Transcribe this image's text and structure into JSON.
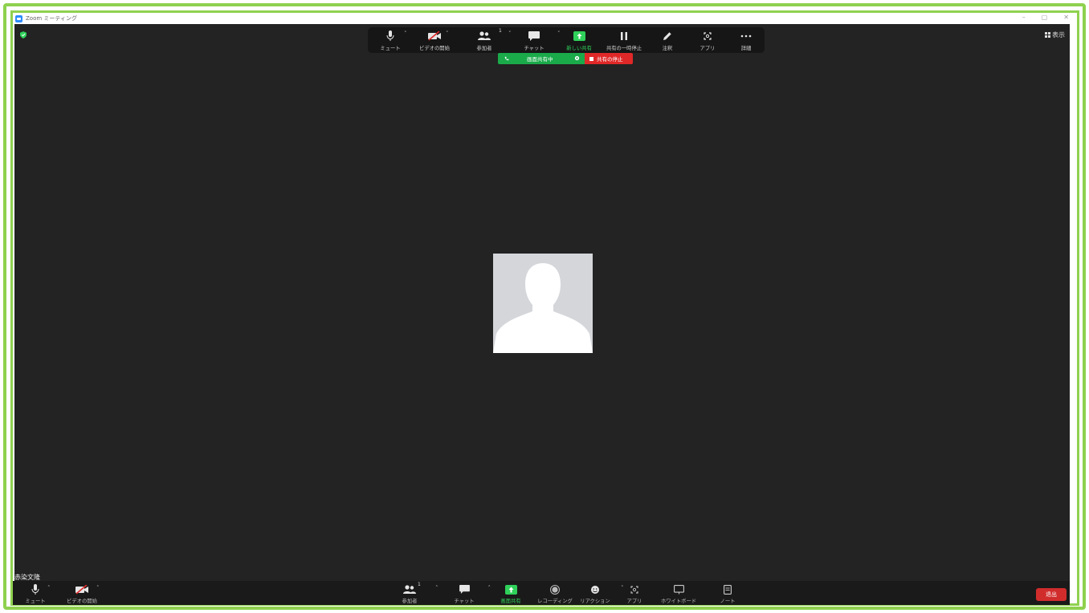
{
  "window": {
    "title": "Zoom ミーティング",
    "controls": [
      "–",
      "▢",
      "✕"
    ]
  },
  "top_toolbar": {
    "items": [
      {
        "label": "ミュート",
        "icon": "mic-icon"
      },
      {
        "label": "ビデオの開始",
        "icon": "video-off-icon"
      },
      {
        "label": "参加者",
        "icon": "participants-icon",
        "count": "1"
      },
      {
        "label": "チャット",
        "icon": "chat-icon"
      },
      {
        "label": "新しい共有",
        "icon": "share-screen-icon"
      },
      {
        "label": "共有の一時停止",
        "icon": "pause-icon"
      },
      {
        "label": "注釈",
        "icon": "pencil-icon"
      },
      {
        "label": "アプリ",
        "icon": "apps-icon"
      },
      {
        "label": "詳細",
        "icon": "more-icon"
      }
    ],
    "view_label": "表示"
  },
  "share_banner": {
    "status": "画面共有中",
    "stop_label": "共有の停止",
    "status_color": "#1aaa4a",
    "stop_color": "#e02828"
  },
  "participant": {
    "name": "赤染文隆"
  },
  "bottom_bar": {
    "items": [
      {
        "label": "ミュート",
        "icon": "mic-icon"
      },
      {
        "label": "ビデオの開始",
        "icon": "video-off-icon"
      },
      {
        "label": "参加者",
        "icon": "participants-icon",
        "count": "1"
      },
      {
        "label": "チャット",
        "icon": "chat-icon"
      },
      {
        "label": "画面共有",
        "icon": "share-screen-icon"
      },
      {
        "label": "レコーディング",
        "icon": "record-icon"
      },
      {
        "label": "リアクション",
        "icon": "reaction-icon"
      },
      {
        "label": "アプリ",
        "icon": "apps-icon"
      },
      {
        "label": "ホワイトボード",
        "icon": "whiteboard-icon"
      },
      {
        "label": "ノート",
        "icon": "notes-icon"
      }
    ],
    "leave_label": "退出"
  },
  "colors": {
    "frame_accent": "#8fd14f",
    "meeting_background": "#232323",
    "share_green": "#2fd15a",
    "leave_red": "#d12c2c"
  }
}
